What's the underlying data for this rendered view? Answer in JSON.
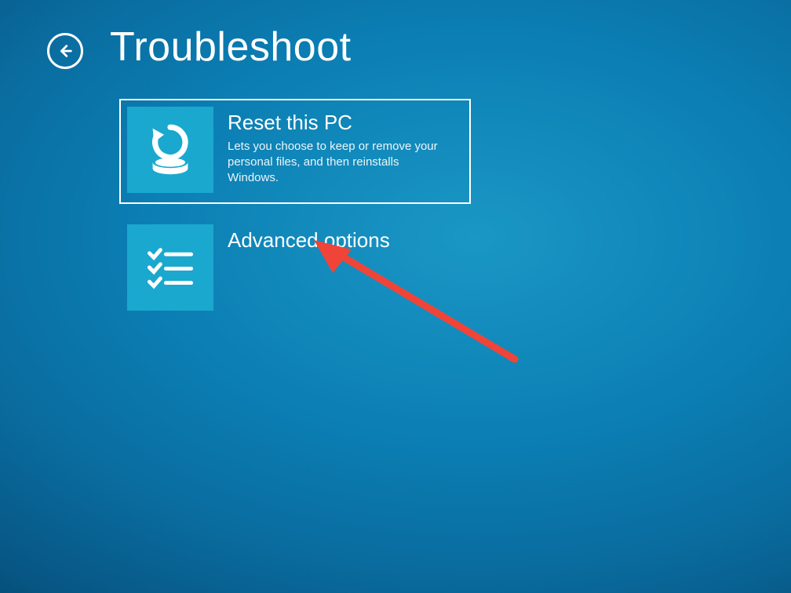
{
  "header": {
    "title": "Troubleshoot",
    "back_aria": "Back"
  },
  "options": [
    {
      "title": "Reset this PC",
      "description": "Lets you choose to keep or remove your personal files, and then reinstalls Windows.",
      "icon": "reset-icon",
      "selected": true
    },
    {
      "title": "Advanced options",
      "description": "",
      "icon": "checklist-icon",
      "selected": false
    }
  ],
  "annotation": {
    "arrow_color": "#f04438"
  }
}
